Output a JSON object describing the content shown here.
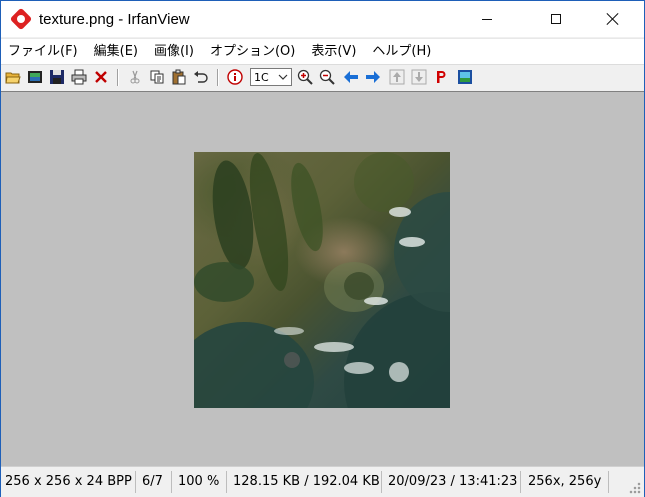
{
  "window": {
    "title": "texture.png - IrfanView",
    "controls": {
      "minimize": "minimize",
      "maximize": "maximize",
      "close": "close"
    }
  },
  "menu": [
    "ファイル(F)",
    "編集(E)",
    "画像(I)",
    "オプション(O)",
    "表示(V)",
    "ヘルプ(H)"
  ],
  "toolbar": {
    "icons": [
      "open-folder-icon",
      "slideshow-icon",
      "save-icon",
      "print-icon",
      "delete-icon",
      "cut-icon",
      "copy-icon",
      "paste-icon",
      "undo-icon",
      "info-icon",
      "zoom-in-icon",
      "zoom-out-icon",
      "previous-arrow-icon",
      "next-arrow-icon",
      "first-file-icon",
      "last-file-icon",
      "paint-icon",
      "skin-icon"
    ],
    "zoom_value": "1C"
  },
  "image": {
    "icon": "texture-image",
    "colors": {
      "land": "#5c6138",
      "sea": "#22423f",
      "surf": "#e8e8e8"
    }
  },
  "statusbar": {
    "dimensions": "256 x 256 x 24 BPP",
    "index": "6/7",
    "zoom": "100 %",
    "size": "128.15 KB / 192.04 KB",
    "datetime": "20/09/23 / 13:41:23",
    "cursor": "256x, 256y"
  },
  "colors": {
    "titlebar_border": "#1e5fb8",
    "client_bg": "#c0c0c0",
    "chrome_bg": "#f0f0f0",
    "arrow_blue": "#1a6fd6",
    "paint_red": "#d00000"
  }
}
